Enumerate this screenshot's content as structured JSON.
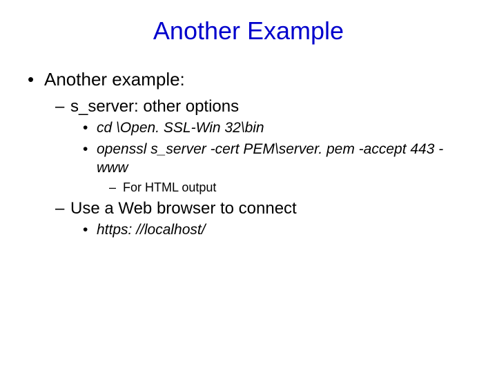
{
  "title": "Another Example",
  "bullets": {
    "top": "Another example:",
    "sub1": "s_server: other options",
    "cmd1": "cd \\Open. SSL-Win 32\\bin",
    "cmd2": "openssl s_server -cert PEM\\server. pem -accept 443 -www",
    "note": "For HTML output",
    "sub2": "Use a Web browser to connect",
    "url": "https: //localhost/"
  }
}
